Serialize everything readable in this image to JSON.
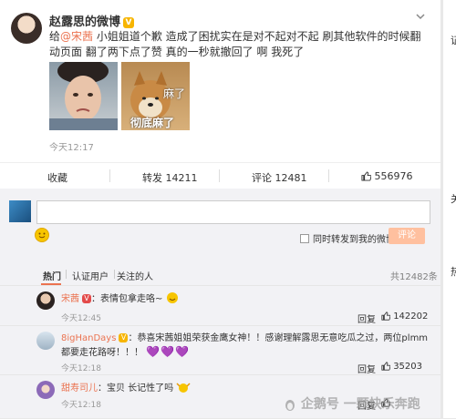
{
  "post": {
    "author": "赵露思的微博",
    "badge_icon": "vip-crown-icon",
    "text_prefix": "给",
    "mention": "@宋茜",
    "text_body": " 小姐姐道个歉 造成了困扰实在是对不起对不起 刷其他软件的时候翻动页面 翻了两下点了赞 真的一秒就撤回了 啊 我死了",
    "image2_caption_top": "麻了",
    "image2_caption_bottom": "彻底麻了",
    "time": "今天12:17"
  },
  "actions": {
    "favorite": "收藏",
    "repost_label": "转发",
    "repost_count": "14211",
    "comment_label": "评论",
    "comment_count": "12481",
    "like_count": "556976"
  },
  "compose": {
    "input_placeholder": "",
    "also_repost_label": "同时转发到我的微博",
    "submit_label": "评论"
  },
  "comment_tabs": {
    "tabs": [
      "热门",
      "认证用户",
      "关注的人"
    ],
    "total": "共12482条"
  },
  "comments": [
    {
      "name": "宋茜",
      "colon": "：",
      "text": "表情包拿走咯~",
      "time": "今天12:45",
      "reply_label": "回复",
      "like_count": "142202"
    },
    {
      "name": "8igHanDays",
      "colon": "：",
      "text": "恭喜宋茜姐姐荣获金鹰女神！！感谢理解露思无意吃瓜之过，两位plmm都要走花路呀！！！",
      "hearts": "💜💜💜",
      "time": "今天12:18",
      "reply_label": "回复",
      "like_count": "35203"
    },
    {
      "name": "甜寿司儿",
      "colon": "：",
      "text": "宝贝 长记性了吗",
      "time": "今天12:18",
      "reply_label": "回复",
      "like_count": ""
    }
  ],
  "right_strip": {
    "items": [
      "证",
      "关",
      "热"
    ]
  },
  "watermark": "企鹅号 一颗快乐奔跑",
  "colors": {
    "accent": "#eb7350",
    "vip": "#f7b500",
    "heart": "#7b5bd6"
  }
}
